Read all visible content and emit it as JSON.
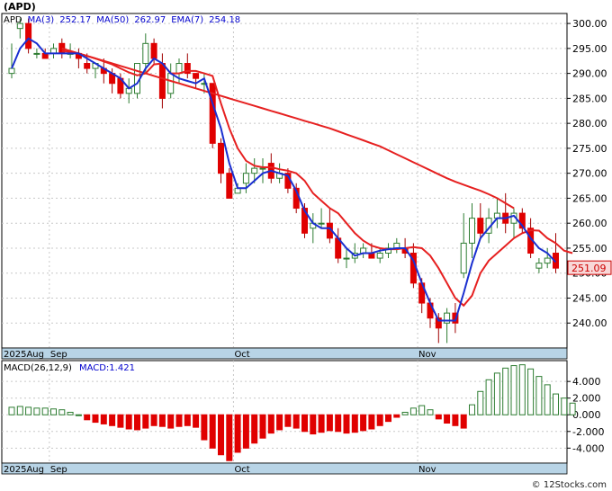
{
  "ticker": "(APD)",
  "footer": "© 12Stocks.com",
  "price_legend": [
    {
      "text": "APD",
      "color": "#000000"
    },
    {
      "text": "MA(3)",
      "color": "#0000cc"
    },
    {
      "text": "252.17",
      "color": "#0000cc"
    },
    {
      "text": "MA(50)",
      "color": "#0000cc"
    },
    {
      "text": "262.97",
      "color": "#0000cc"
    },
    {
      "text": "EMA(7)",
      "color": "#0000cc"
    },
    {
      "text": "254.18",
      "color": "#0000cc"
    }
  ],
  "macd_legend": [
    {
      "text": "MACD(26,12,9)",
      "color": "#000000"
    },
    {
      "text": "MACD:1.421",
      "color": "#0000cc"
    }
  ],
  "colors": {
    "up": "#2e7d32",
    "down": "#e00000",
    "ma_blue": "#1a2fd0",
    "ema_red": "#e62020",
    "axis_band": "#b8d4e6",
    "grid": "#c8c8c8",
    "last_price_box": "#f8d8d8"
  },
  "chart_data": [
    {
      "type": "candlestick",
      "title": "APD",
      "last_price_label": "251.09",
      "ylim": [
        235,
        302
      ],
      "y_ticks": [
        "240.00",
        "245.00",
        "250.00",
        "255.00",
        "260.00",
        "265.00",
        "270.00",
        "275.00",
        "280.00",
        "285.00",
        "290.00",
        "295.00",
        "300.00"
      ],
      "x_labels": [
        {
          "text": "2025Aug",
          "index": 0
        },
        {
          "text": "Sep",
          "index": 5
        },
        {
          "text": "Oct",
          "index": 27
        },
        {
          "text": "Nov",
          "index": 49
        }
      ],
      "ohlc": [
        [
          290,
          296,
          289,
          291
        ],
        [
          299,
          301,
          297,
          300
        ],
        [
          300,
          301,
          294,
          295
        ],
        [
          294,
          295,
          293,
          294
        ],
        [
          294,
          295,
          293,
          293
        ],
        [
          294,
          296,
          293,
          295
        ],
        [
          296,
          297,
          293,
          294
        ],
        [
          294,
          296,
          293,
          294
        ],
        [
          294,
          295,
          291,
          293
        ],
        [
          292,
          294,
          290,
          291
        ],
        [
          291,
          292,
          289,
          292
        ],
        [
          291,
          293,
          288,
          290
        ],
        [
          290,
          291,
          286,
          288
        ],
        [
          289,
          290,
          285,
          286
        ],
        [
          286,
          289,
          284,
          287
        ],
        [
          286,
          292,
          285,
          292
        ],
        [
          292,
          298,
          290,
          296
        ],
        [
          296,
          297,
          292,
          293
        ],
        [
          292,
          294,
          283,
          285
        ],
        [
          286,
          292,
          285,
          290
        ],
        [
          290,
          293,
          288,
          292
        ],
        [
          292,
          294,
          289,
          290
        ],
        [
          290,
          290,
          287,
          289
        ],
        [
          288,
          290,
          286,
          288
        ],
        [
          288,
          288,
          275,
          276
        ],
        [
          276,
          277,
          268,
          270
        ],
        [
          270,
          271,
          265,
          265
        ],
        [
          266,
          268,
          266,
          267
        ],
        [
          268,
          272,
          266,
          270
        ],
        [
          270,
          273,
          268,
          271
        ],
        [
          271,
          273,
          268,
          271
        ],
        [
          272,
          274,
          268,
          269
        ],
        [
          269,
          272,
          268,
          270
        ],
        [
          270,
          271,
          266,
          267
        ],
        [
          267,
          268,
          262,
          263
        ],
        [
          263,
          264,
          257,
          258
        ],
        [
          259,
          262,
          256,
          260
        ],
        [
          260,
          263,
          259,
          260
        ],
        [
          260,
          263,
          256,
          257
        ],
        [
          257,
          259,
          252,
          253
        ],
        [
          253,
          255,
          251,
          253
        ],
        [
          253,
          256,
          252,
          254
        ],
        [
          254,
          256,
          253,
          255
        ],
        [
          254,
          256,
          253,
          253
        ],
        [
          253,
          255,
          252,
          254
        ],
        [
          254,
          256,
          253,
          255
        ],
        [
          255,
          257,
          254,
          256
        ],
        [
          255,
          257,
          253,
          254
        ],
        [
          254,
          256,
          247,
          248
        ],
        [
          248,
          249,
          242,
          244
        ],
        [
          244,
          245,
          239,
          241
        ],
        [
          241,
          242,
          236,
          239
        ],
        [
          240,
          243,
          236,
          242
        ],
        [
          242,
          244,
          238,
          240
        ],
        [
          250,
          262,
          249,
          256
        ],
        [
          256,
          264,
          253,
          261
        ],
        [
          261,
          264,
          257,
          258
        ],
        [
          258,
          263,
          256,
          261
        ],
        [
          261,
          265,
          259,
          262
        ],
        [
          262,
          266,
          258,
          260
        ],
        [
          260,
          263,
          257,
          262
        ],
        [
          262,
          263,
          258,
          259
        ],
        [
          259,
          261,
          253,
          254
        ],
        [
          251,
          253,
          250,
          252
        ],
        [
          252,
          255,
          251,
          253
        ],
        [
          254,
          258,
          250,
          251
        ]
      ],
      "series": [
        {
          "name": "MA(50)",
          "color": "#e62020",
          "start": 6,
          "values": [
            295,
            294.5,
            294,
            293.5,
            293,
            292.5,
            292,
            291.5,
            291,
            290.5,
            290,
            289.5,
            289,
            288.5,
            288,
            287.5,
            287,
            286.5,
            286,
            285.5,
            285,
            284.5,
            284,
            283.5,
            283,
            282.5,
            282,
            281.5,
            281,
            280.5,
            280,
            279.5,
            279,
            278.4,
            277.8,
            277.2,
            276.6,
            276,
            275.4,
            274.6,
            273.8,
            273,
            272.2,
            271.4,
            270.6,
            269.8,
            269,
            268.3,
            267.7,
            267.1,
            266.5,
            265.8,
            265,
            264,
            263
          ]
        },
        {
          "name": "EMA(7)",
          "color": "#e62020",
          "start": 6,
          "values": [
            294.5,
            294.3,
            294,
            293.5,
            293,
            292.4,
            291.8,
            291,
            290.2,
            289.6,
            290,
            291.8,
            292,
            290,
            290,
            290.5,
            290.5,
            290,
            289.5,
            284,
            279,
            275,
            272.5,
            271.5,
            271.2,
            271.2,
            270.8,
            270.5,
            270,
            268.5,
            266,
            264.5,
            263,
            262,
            260,
            258,
            256.5,
            255.5,
            255,
            254.8,
            254.8,
            255,
            255.2,
            255,
            253.5,
            251,
            248,
            245,
            243.5,
            245.5,
            250,
            252.5,
            254,
            255.5,
            257,
            258,
            258.6,
            258.5,
            257,
            256,
            254.5,
            254
          ]
        },
        {
          "name": "MA(3)",
          "color": "#1a2fd0",
          "start": 0,
          "values": [
            291,
            295,
            297,
            296,
            294,
            294,
            294,
            294,
            294,
            293,
            292,
            291,
            290,
            289,
            287,
            288,
            291,
            293,
            292,
            290,
            289,
            288.5,
            288,
            289,
            284,
            279,
            272,
            267,
            267,
            268.5,
            270,
            270.5,
            270,
            269.5,
            266.5,
            262.5,
            260,
            259,
            259,
            257,
            255,
            253.5,
            254,
            254,
            254.5,
            254.8,
            255,
            255,
            252.5,
            248,
            244,
            240.5,
            240.5,
            240.5,
            246,
            252,
            257,
            259,
            261,
            261,
            261.5,
            259.5,
            257,
            255,
            254,
            252.2
          ]
        }
      ]
    },
    {
      "type": "bar",
      "title": "MACD(26,12,9)",
      "ylim": [
        -5.8,
        6.5
      ],
      "y_ticks": [
        "4.000",
        "2.000",
        "0.000",
        "-2.000",
        "-4.000"
      ],
      "x_labels": [
        {
          "text": "2025Aug",
          "index": 0
        },
        {
          "text": "Sep",
          "index": 5
        },
        {
          "text": "Oct",
          "index": 27
        },
        {
          "text": "Nov",
          "index": 49
        }
      ],
      "values": [
        0.9,
        1.0,
        0.9,
        0.8,
        0.8,
        0.7,
        0.6,
        0.3,
        0,
        -0.6,
        -0.9,
        -1.1,
        -1.3,
        -1.5,
        -1.7,
        -1.8,
        -1.6,
        -1.3,
        -1.4,
        -1.6,
        -1.4,
        -1.3,
        -1.5,
        -3.0,
        -4.0,
        -4.8,
        -5.5,
        -4.5,
        -4.0,
        -3.4,
        -2.8,
        -2.2,
        -1.8,
        -1.4,
        -1.6,
        -2.0,
        -2.3,
        -2.1,
        -1.9,
        -2.0,
        -2.2,
        -2.1,
        -1.9,
        -1.7,
        -1.3,
        -0.8,
        -0.3,
        0.3,
        0.8,
        1.1,
        0.6,
        -0.5,
        -1.0,
        -1.3,
        -1.6,
        1.2,
        2.8,
        4.2,
        5.0,
        5.6,
        5.9,
        6.0,
        5.5,
        4.6,
        3.6,
        2.5,
        2.0,
        1.4
      ]
    }
  ]
}
